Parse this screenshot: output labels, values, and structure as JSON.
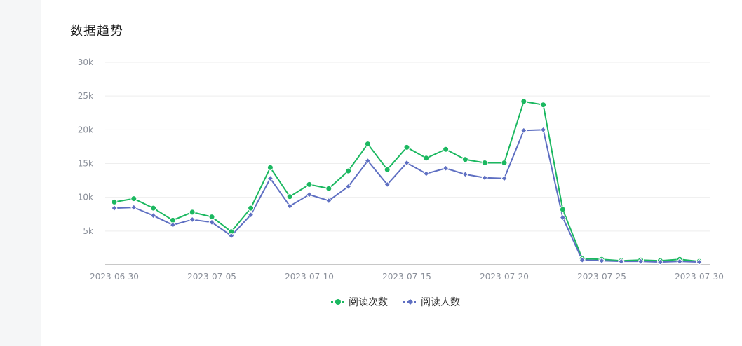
{
  "panel": {
    "title": "数据趋势"
  },
  "chart_data": {
    "type": "line",
    "title": "",
    "xlabel": "",
    "ylabel": "",
    "x": [
      "2023-06-30",
      "2023-07-01",
      "2023-07-02",
      "2023-07-03",
      "2023-07-04",
      "2023-07-05",
      "2023-07-06",
      "2023-07-07",
      "2023-07-08",
      "2023-07-09",
      "2023-07-10",
      "2023-07-11",
      "2023-07-12",
      "2023-07-13",
      "2023-07-14",
      "2023-07-15",
      "2023-07-16",
      "2023-07-17",
      "2023-07-18",
      "2023-07-19",
      "2023-07-20",
      "2023-07-21",
      "2023-07-22",
      "2023-07-23",
      "2023-07-24",
      "2023-07-25",
      "2023-07-26",
      "2023-07-27",
      "2023-07-28",
      "2023-07-29",
      "2023-07-30"
    ],
    "x_tick_labels": [
      "2023-06-30",
      "2023-07-05",
      "2023-07-10",
      "2023-07-15",
      "2023-07-20",
      "2023-07-25",
      "2023-07-30"
    ],
    "ylim": [
      0,
      30000
    ],
    "y_tick_values": [
      5000,
      10000,
      15000,
      20000,
      25000,
      30000
    ],
    "y_tick_labels": [
      "5k",
      "10k",
      "15k",
      "20k",
      "25k",
      "30k"
    ],
    "grid": true,
    "legend_position": "bottom-center",
    "series": [
      {
        "name": "阅读次数",
        "color": "#1bb860",
        "marker": "circle",
        "values": [
          9300,
          9800,
          8400,
          6600,
          7800,
          7100,
          4900,
          8400,
          14400,
          10100,
          11900,
          11300,
          13900,
          17900,
          14100,
          17400,
          15800,
          17100,
          15600,
          15100,
          15100,
          24200,
          23700,
          8200,
          900,
          800,
          600,
          700,
          600,
          800,
          500
        ]
      },
      {
        "name": "阅读人数",
        "color": "#5e6fc2",
        "marker": "diamond",
        "values": [
          8400,
          8500,
          7300,
          5900,
          6700,
          6300,
          4300,
          7400,
          12800,
          8700,
          10400,
          9500,
          11600,
          15400,
          11900,
          15100,
          13500,
          14300,
          13400,
          12900,
          12800,
          19900,
          20000,
          7000,
          700,
          600,
          500,
          500,
          400,
          500,
          400
        ]
      }
    ]
  }
}
